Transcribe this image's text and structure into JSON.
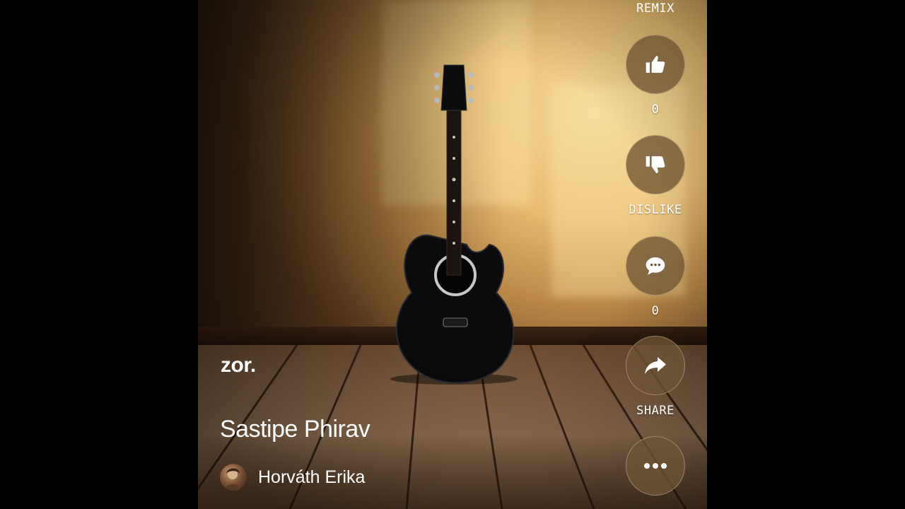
{
  "video": {
    "watermark": "zor.",
    "song_title": "Sastipe Phirav",
    "artist_name": "Horváth Erika"
  },
  "actions": {
    "remix_label": "REMIX",
    "like": {
      "icon": "thumbs-up-icon",
      "count": "0"
    },
    "dislike": {
      "icon": "thumbs-down-icon",
      "label": "DISLIKE"
    },
    "comment": {
      "icon": "comment-icon",
      "count": "0"
    },
    "share": {
      "icon": "share-arrow-icon",
      "label": "SHARE"
    },
    "more": {
      "icon": "more-dots-icon"
    }
  },
  "colors": {
    "page_background": "#000000",
    "button_fill": "#6e5434",
    "text": "#ffffff"
  }
}
